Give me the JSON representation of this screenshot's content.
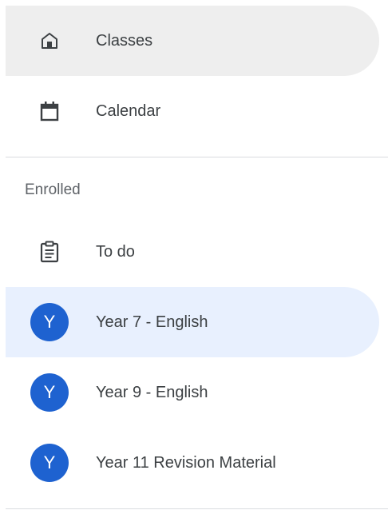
{
  "nav": {
    "top_items": [
      {
        "label": "Classes",
        "icon": "home-icon"
      },
      {
        "label": "Calendar",
        "icon": "calendar-icon"
      }
    ],
    "section_title": "Enrolled",
    "todo": {
      "label": "To do",
      "icon": "assignment-icon"
    },
    "classes": [
      {
        "label": "Year 7 - English",
        "avatar_letter": "Y"
      },
      {
        "label": "Year 9 - English",
        "avatar_letter": "Y"
      },
      {
        "label": "Year 11 Revision Material",
        "avatar_letter": "Y"
      }
    ]
  },
  "colors": {
    "avatar": "#1e62d0",
    "selected_bg": "#e8f0fe",
    "hover_bg": "#eeeeee",
    "text": "#3c4043",
    "section_text": "#5f6368",
    "divider": "#dadce0"
  }
}
